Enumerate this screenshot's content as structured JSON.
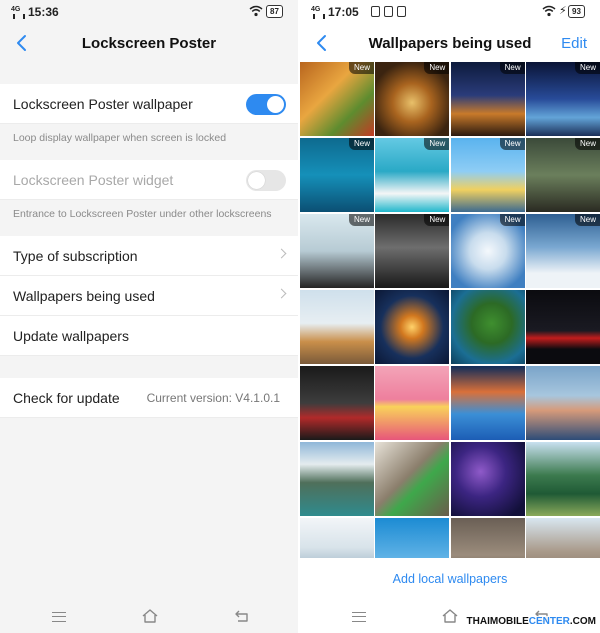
{
  "left": {
    "status": {
      "signal": "4G",
      "time": "15:36",
      "battery": "87"
    },
    "header": {
      "title": "Lockscreen Poster"
    },
    "poster_wallpaper": {
      "label": "Lockscreen Poster wallpaper",
      "enabled": true,
      "description": "Loop display wallpaper when screen is locked"
    },
    "poster_widget": {
      "label": "Lockscreen Poster widget",
      "enabled": false,
      "description": "Entrance to Lockscreen Poster under other lockscreens"
    },
    "menu": {
      "type_of_subscription": "Type of subscription",
      "wallpapers_being_used": "Wallpapers being used",
      "update_wallpapers": "Update wallpapers"
    },
    "check_update": {
      "label": "Check for update",
      "version": "Current version: V4.1.0.1"
    }
  },
  "right": {
    "status": {
      "signal": "4G",
      "time": "17:05",
      "battery": "93"
    },
    "header": {
      "title": "Wallpapers being used",
      "edit_label": "Edit"
    },
    "badge_label": "New",
    "tiles": [
      {
        "name": "food-platter",
        "bg": "linear-gradient(135deg,#b8651e 0%,#e9a640 40%,#5e8c2f 70%,#c23a24 100%)",
        "new": true
      },
      {
        "name": "noodle-bowl",
        "bg": "radial-gradient(circle at 50% 55%,#e8c06a 0%,#a9641f 35%,#3b2410 75%)",
        "new": true
      },
      {
        "name": "camp-tent-night",
        "bg": "linear-gradient(180deg,#0d1a3c 0%,#2a3c7a 45%,#c87a2a 70%,#2b1a10 100%)",
        "new": true
      },
      {
        "name": "milky-way-lake",
        "bg": "linear-gradient(180deg,#0a1436 0%,#284b99 50%,#63a4d8 75%,#1a2e57 100%)",
        "new": true
      },
      {
        "name": "yellow-kayak",
        "bg": "linear-gradient(180deg,#0e6a8f 0%,#1590b9 50%,#0b4f73 100%)",
        "new": true
      },
      {
        "name": "beach-hat-woman",
        "bg": "linear-gradient(180deg,#64c9e3 0%,#2aa9c6 45%,#f4f6f6 75%,#21b7cc 100%)",
        "new": true
      },
      {
        "name": "mountain-hiker",
        "bg": "linear-gradient(180deg,#5ab3ee 0%,#8ecdf5 45%,#f0d060 70%,#3d6a8f 100%)",
        "new": true
      },
      {
        "name": "mountain-biker",
        "bg": "linear-gradient(180deg,#3b4a3a 0%,#6b7f5c 50%,#2a2a22 100%)",
        "new": true
      },
      {
        "name": "woman-sunglasses",
        "bg": "linear-gradient(180deg,#d9e8ee 0%,#b7cbd4 50%,#242424 100%)",
        "new": true
      },
      {
        "name": "man-in-suit",
        "bg": "linear-gradient(180deg,#2b2b2b 0%,#6e6e6e 45%,#191919 100%)",
        "new": true
      },
      {
        "name": "white-kitten",
        "bg": "radial-gradient(circle at 50% 50%,#f4f8fc 0%,#c8dced 35%,#3f7fc1 80%)",
        "new": true
      },
      {
        "name": "arctic-fox",
        "bg": "linear-gradient(180deg,#2e5f92 0%,#7aa8d1 45%,#eef3f7 80%)",
        "new": true
      },
      {
        "name": "giraffe",
        "bg": "linear-gradient(180deg,#cfe0ec 0%,#e7eef2 45%,#c98f4a 70%,#7a5a3a 100%)",
        "new": false
      },
      {
        "name": "lantern-night",
        "bg": "radial-gradient(circle at 50% 50%,#ffd26a 0%,#d2781f 22%,#17305c 60%,#0b1734 100%)",
        "new": false
      },
      {
        "name": "green-island",
        "bg": "radial-gradient(circle at 55% 45%,#3f8f2f 0%,#2c6a25 35%,#1b6e94 70%,#0d3f5c 100%)",
        "new": false
      },
      {
        "name": "red-sports-car",
        "bg": "linear-gradient(180deg,#0b0b0f 0%,#1a1a22 55%,#c21d1d 65%,#0b0b0f 80%)",
        "new": false
      },
      {
        "name": "go-kart-racer",
        "bg": "linear-gradient(180deg,#1a1a1a 0%,#3d3d3d 50%,#b12a2a 70%,#1a1a1a 100%)",
        "new": false
      },
      {
        "name": "fashion-woman",
        "bg": "linear-gradient(180deg,#f3a4b8 0%,#ee7f9d 45%,#f9d25a 55%,#e7567a 100%)",
        "new": false
      },
      {
        "name": "resort-pool",
        "bg": "linear-gradient(180deg,#0f2c5a 0%,#d9703a 35%,#3b8fd6 65%,#1c5db5 100%)",
        "new": false
      },
      {
        "name": "push-up-man",
        "bg": "linear-gradient(180deg,#7aa4c9 0%,#a7c6de 40%,#d69a7a 60%,#2d4c78 100%)",
        "new": false
      },
      {
        "name": "mountain-lake",
        "bg": "linear-gradient(180deg,#8fb7d8 0%,#e4ecef 30%,#4f6f5a 55%,#2f8b8e 100%)",
        "new": false
      },
      {
        "name": "rock-climber",
        "bg": "linear-gradient(135deg,#e7e2d8 0%,#8b7e6c 45%,#3ea84b 60%,#6b5b4b 100%)",
        "new": false
      },
      {
        "name": "galaxy-stars",
        "bg": "radial-gradient(circle at 40% 40%,#8f5ac9 0%,#3c2582 40%,#12103a 85%)",
        "new": false
      },
      {
        "name": "forest-meadow",
        "bg": "linear-gradient(180deg,#c8e0f0 0%,#3c7a4e 45%,#1f5a35 70%,#8aa95b 100%)",
        "new": false
      },
      {
        "name": "marina-bay",
        "bg": "linear-gradient(180deg,#f2f5f8 0%,#d8e3ea 40%,#9fb6c6 70%,#4d6579 100%)",
        "new": false
      },
      {
        "name": "hot-air-balloon",
        "bg": "linear-gradient(180deg,#1c8bd3 0%,#67b7e8 60%,#d63027 80%,#67b7e8 100%)",
        "new": false
      },
      {
        "name": "bearded-man",
        "bg": "linear-gradient(180deg,#6a5f55 0%,#9b8c7c 50%,#3a302a 100%)",
        "new": false
      },
      {
        "name": "rock-arch",
        "bg": "linear-gradient(180deg,#d8e6f0 0%,#a99a8a 45%,#6f5f50 100%)",
        "new": false
      }
    ],
    "add_link": "Add local wallpapers",
    "watermark": {
      "prefix": "THAIMOBILE",
      "accent": "CENTER",
      "suffix": ".COM"
    }
  },
  "colors": {
    "accent": "#2e8af0",
    "toggle_off": "#e6e6e6",
    "background": "#f4f4f4"
  }
}
